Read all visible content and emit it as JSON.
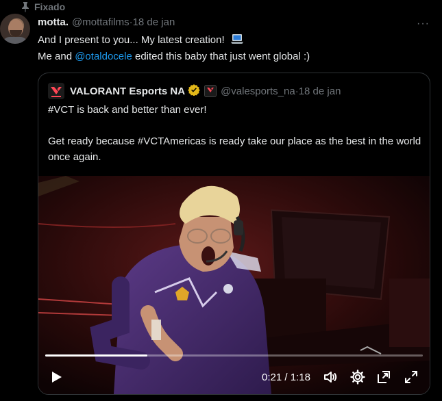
{
  "pinned": {
    "label": "Fixado",
    "icon": "pin-icon"
  },
  "tweet": {
    "author_name": "motta.",
    "handle": "@mottafilms",
    "date": "18 de jan",
    "separator": " · ",
    "line1": "And I present to you... My latest creation!",
    "line1_emoji": "laptop-emoji",
    "line2_prefix": "Me and ",
    "line2_mention": "@otaldocele",
    "line2_suffix": " edited this baby that just went global :)",
    "more_icon": "···"
  },
  "quote": {
    "author_name": "VALORANT Esports NA",
    "handle": "@valesports_na",
    "date": "18 de jan",
    "separator": " · ",
    "paragraph1": "#VCT is back and better than ever!",
    "paragraph2": "Get ready because #VCTAmericas is ready take our place as the best in the world once again.",
    "verified_color": "#e2b719",
    "accent_color": "#ff4655"
  },
  "video": {
    "current_time": "0:21",
    "duration": "1:18",
    "time_separator": " / ",
    "progress": 0.27
  }
}
